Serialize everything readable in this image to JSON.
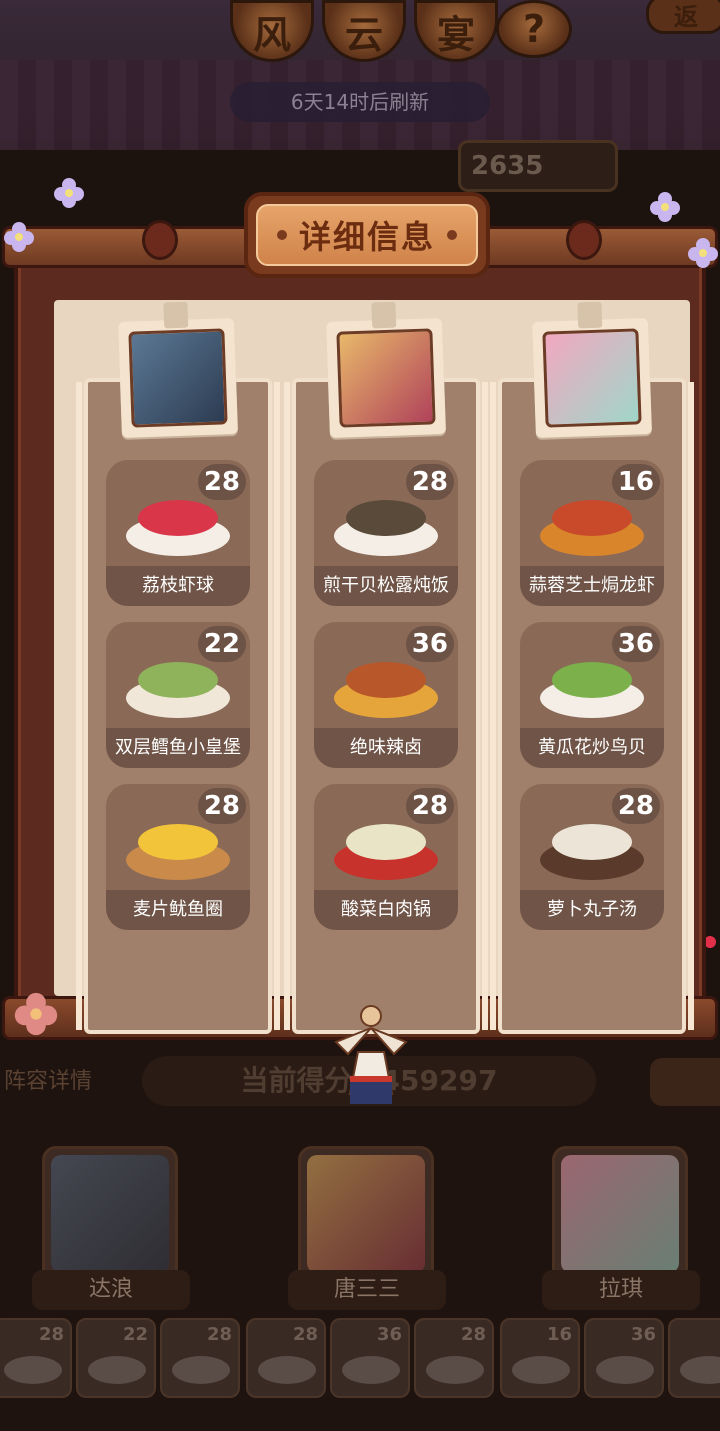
{
  "top": {
    "title_chars": [
      "风",
      "云",
      "宴"
    ],
    "help_symbol": "?",
    "corner_badge": "返",
    "refresh_text": "6天14时后刷新",
    "score_chip": "2635"
  },
  "modal": {
    "title": "详细信息",
    "columns": [
      {
        "chef": "达浪",
        "avatar_colors": [
          "#5c7894",
          "#2c3c52"
        ],
        "dishes": [
          {
            "name": "荔枝虾球",
            "count": "28",
            "colors": [
              "#f4eee6",
              "#d9364a"
            ]
          },
          {
            "name": "双层鳕鱼小皇堡",
            "count": "22",
            "colors": [
              "#f1e7d9",
              "#8fb35a"
            ]
          },
          {
            "name": "麦片鱿鱼圈",
            "count": "28",
            "colors": [
              "#c98a4a",
              "#f2c43a"
            ]
          }
        ]
      },
      {
        "chef": "唐三三",
        "avatar_colors": [
          "#e8b86a",
          "#b0425a"
        ],
        "dishes": [
          {
            "name": "煎干贝松露炖饭",
            "count": "28",
            "colors": [
              "#f4eee6",
              "#5a4a3a"
            ]
          },
          {
            "name": "绝味辣卤",
            "count": "36",
            "colors": [
              "#e6a53a",
              "#b8572a"
            ]
          },
          {
            "name": "酸菜白肉锅",
            "count": "28",
            "colors": [
              "#c8322c",
              "#e9e4c6"
            ]
          }
        ]
      },
      {
        "chef": "拉琪",
        "avatar_colors": [
          "#f2a8c0",
          "#9fd6c8"
        ],
        "dishes": [
          {
            "name": "蒜蓉芝士焗龙虾",
            "count": "16",
            "colors": [
              "#d8852c",
              "#c94a2a"
            ]
          },
          {
            "name": "黄瓜花炒鸟贝",
            "count": "36",
            "colors": [
              "#f4eee6",
              "#7bb04a"
            ]
          },
          {
            "name": "萝卜丸子汤",
            "count": "28",
            "colors": [
              "#5a3a2a",
              "#ece4d6"
            ]
          }
        ]
      }
    ]
  },
  "background": {
    "lineup_tab": "阵容详情",
    "current_score": "当前得分：459297",
    "chef_names": [
      "达浪",
      "唐三三",
      "拉琪"
    ],
    "strip_counts": [
      "28",
      "22",
      "28",
      "28",
      "36",
      "28",
      "16",
      "36",
      ""
    ]
  }
}
